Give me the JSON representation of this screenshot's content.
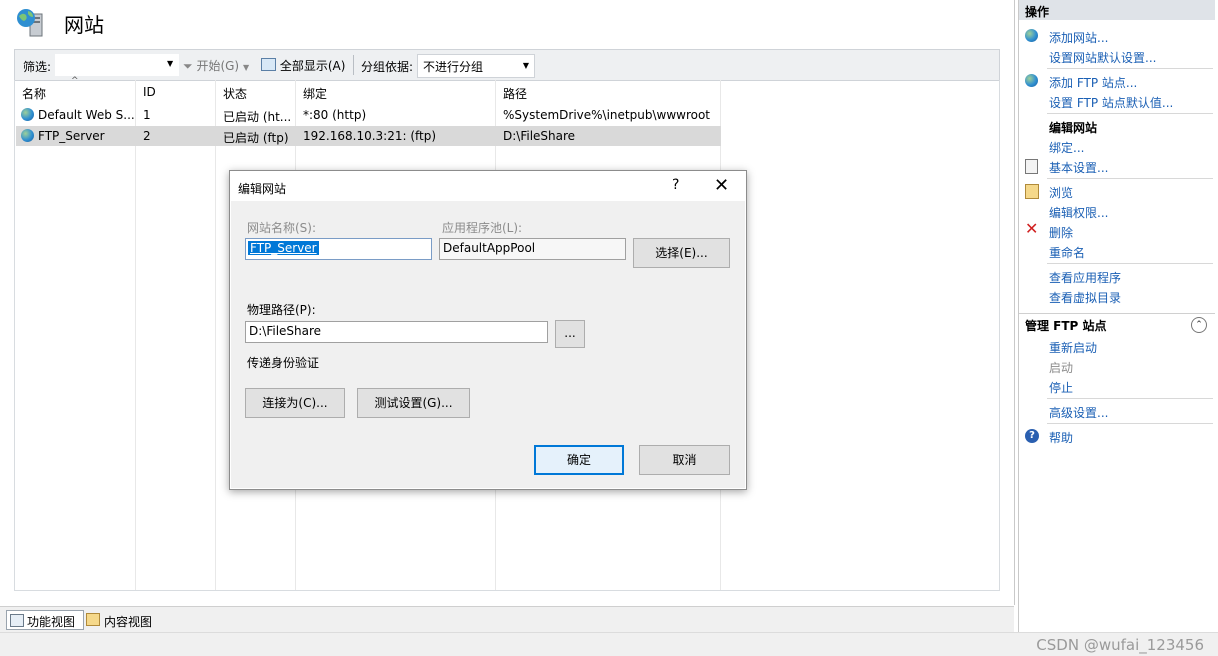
{
  "page": {
    "title": "网站"
  },
  "filterbar": {
    "filter_label": "筛选:",
    "filter_value": "",
    "start_label": "开始(G)",
    "show_all_label": "全部显示(A)",
    "group_by_label": "分组依据:",
    "group_by_value": "不进行分组"
  },
  "table": {
    "columns": [
      "名称",
      "ID",
      "状态",
      "绑定",
      "路径"
    ],
    "rows": [
      {
        "name": "Default Web S...",
        "id": "1",
        "status": "已启动 (ht...",
        "binding": "*:80 (http)",
        "path": "%SystemDrive%\\inetpub\\wwwroot"
      },
      {
        "name": "FTP_Server",
        "id": "2",
        "status": "已启动 (ftp)",
        "binding": "192.168.10.3:21: (ftp)",
        "path": "D:\\FileShare"
      }
    ]
  },
  "bottom_tabs": {
    "feature_view": "功能视图",
    "content_view": "内容视图"
  },
  "watermark": "CSDN @wufai_123456",
  "actions": {
    "header": "操作",
    "add_site": "添加网站...",
    "site_defaults": "设置网站默认设置...",
    "add_ftp": "添加 FTP 站点...",
    "ftp_defaults": "设置 FTP 站点默认值...",
    "edit_site_title": "编辑网站",
    "bindings": "绑定...",
    "basic_settings": "基本设置...",
    "browse": "浏览",
    "edit_permissions": "编辑权限...",
    "delete": "删除",
    "rename": "重命名",
    "view_apps": "查看应用程序",
    "view_vdirs": "查看虚拟目录",
    "manage_ftp_header": "管理 FTP 站点",
    "restart": "重新启动",
    "start": "启动",
    "stop": "停止",
    "advanced": "高级设置...",
    "help": "帮助"
  },
  "dialog": {
    "title": "编辑网站",
    "help_glyph": "?",
    "close_glyph": "✕",
    "site_name_label": "网站名称(S):",
    "site_name_value": "FTP_Server",
    "app_pool_label": "应用程序池(L):",
    "app_pool_value": "DefaultAppPool",
    "select_button": "选择(E)...",
    "physical_path_label": "物理路径(P):",
    "physical_path_value": "D:\\FileShare",
    "browse_button": "...",
    "pass_through_label": "传递身份验证",
    "connect_as_button": "连接为(C)...",
    "test_settings_button": "测试设置(G)...",
    "ok_button": "确定",
    "cancel_button": "取消"
  }
}
